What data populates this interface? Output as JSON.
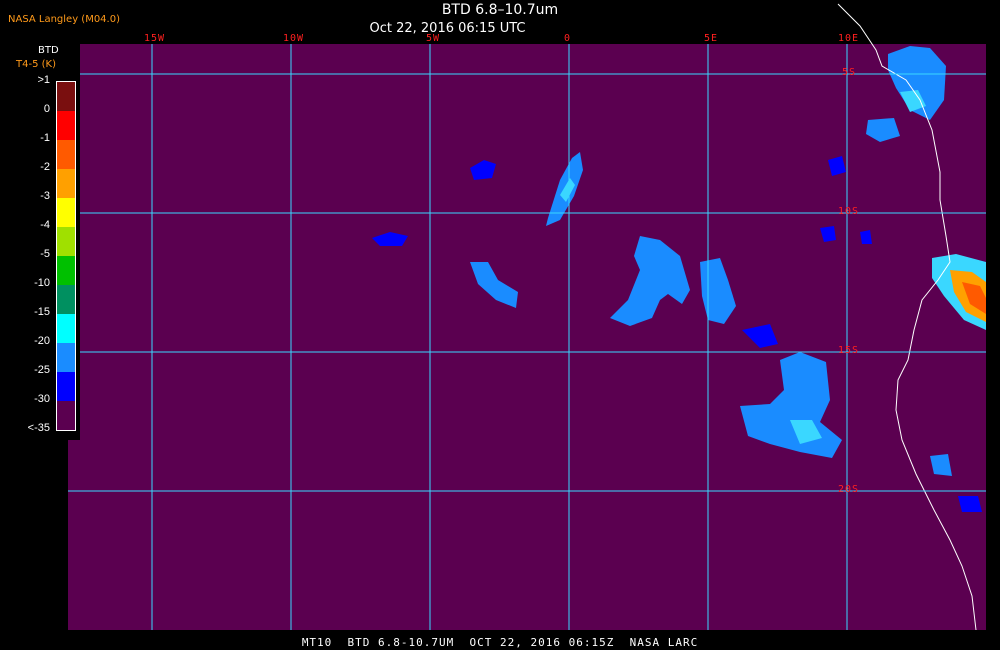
{
  "header": {
    "source": "NASA Langley (M04.0)",
    "title": "BTD 6.8–10.7um",
    "datetime": "Oct 22, 2016 06:15 UTC"
  },
  "legend": {
    "title": "BTD",
    "unit": "T4-5 (K)",
    "labels": [
      ">1",
      "0",
      "-1",
      "-2",
      "-3",
      "-4",
      "-5",
      "-10",
      "-15",
      "-20",
      "-25",
      "-30",
      "<-35"
    ],
    "colors": [
      "#7a0f0f",
      "#ff0000",
      "#ff5a00",
      "#ffa000",
      "#ffff00",
      "#a0e000",
      "#00c000",
      "#009060",
      "#00ffff",
      "#1a8cff",
      "#0000ff",
      "#5b0050"
    ]
  },
  "grid": {
    "lon_labels": [
      "15W",
      "10W",
      "5W",
      "0",
      "5E",
      "10E"
    ],
    "lat_labels": [
      "5S",
      "10S",
      "15S",
      "20S"
    ]
  },
  "map": {
    "background_color": "#5b0050",
    "grid_color": "#3ad7ff",
    "coast_color": "#ffffff"
  },
  "footer": {
    "text": "MT10  BTD 6.8-10.7UM  OCT 22, 2016 06:15Z  NASA LARC"
  }
}
